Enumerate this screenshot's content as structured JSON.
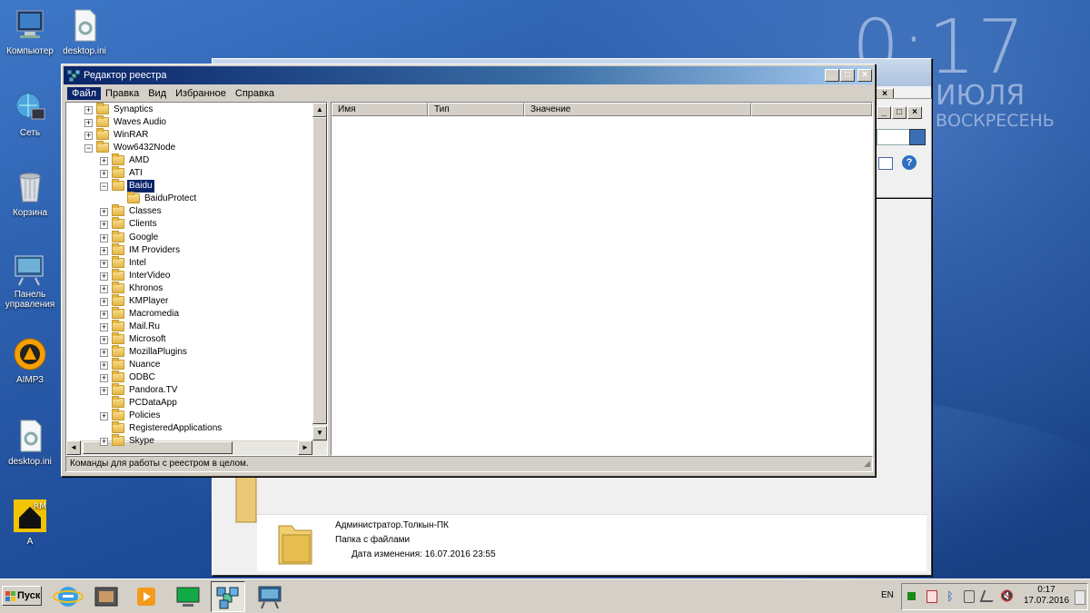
{
  "desktop": {
    "icons": [
      {
        "label": "Компьютер"
      },
      {
        "label": "desktop.ini"
      },
      {
        "label": "Сеть"
      },
      {
        "label": "Корзина"
      },
      {
        "label": "Панель управления"
      },
      {
        "label": "AIMP3"
      },
      {
        "label": "desktop.ini"
      },
      {
        "label": "A"
      }
    ],
    "gadget": {
      "time": "0:17",
      "month": "ИЮЛЯ",
      "day": "ВОСКРЕСЕНЬ"
    }
  },
  "regedit": {
    "title": "Редактор реестра",
    "menu": [
      "Файл",
      "Правка",
      "Вид",
      "Избранное",
      "Справка"
    ],
    "tree": [
      {
        "label": "Synaptics",
        "depth": 0,
        "expander": "+"
      },
      {
        "label": "Waves Audio",
        "depth": 0,
        "expander": "+"
      },
      {
        "label": "WinRAR",
        "depth": 0,
        "expander": "+"
      },
      {
        "label": "Wow6432Node",
        "depth": 0,
        "expander": "-"
      },
      {
        "label": "AMD",
        "depth": 1,
        "expander": "+"
      },
      {
        "label": "ATI",
        "depth": 1,
        "expander": "+"
      },
      {
        "label": "Baidu",
        "depth": 1,
        "expander": "-",
        "selected": true
      },
      {
        "label": "BaiduProtect",
        "depth": 2,
        "expander": ""
      },
      {
        "label": "Classes",
        "depth": 1,
        "expander": "+"
      },
      {
        "label": "Clients",
        "depth": 1,
        "expander": "+"
      },
      {
        "label": "Google",
        "depth": 1,
        "expander": "+"
      },
      {
        "label": "IM Providers",
        "depth": 1,
        "expander": "+"
      },
      {
        "label": "Intel",
        "depth": 1,
        "expander": "+"
      },
      {
        "label": "InterVideo",
        "depth": 1,
        "expander": "+"
      },
      {
        "label": "Khronos",
        "depth": 1,
        "expander": "+"
      },
      {
        "label": "KMPlayer",
        "depth": 1,
        "expander": "+"
      },
      {
        "label": "Macromedia",
        "depth": 1,
        "expander": "+"
      },
      {
        "label": "Mail.Ru",
        "depth": 1,
        "expander": "+"
      },
      {
        "label": "Microsoft",
        "depth": 1,
        "expander": "+"
      },
      {
        "label": "MozillaPlugins",
        "depth": 1,
        "expander": "+"
      },
      {
        "label": "Nuance",
        "depth": 1,
        "expander": "+"
      },
      {
        "label": "ODBC",
        "depth": 1,
        "expander": "+"
      },
      {
        "label": "Pandora.TV",
        "depth": 1,
        "expander": "+"
      },
      {
        "label": "PCDataApp",
        "depth": 1,
        "expander": ""
      },
      {
        "label": "Policies",
        "depth": 1,
        "expander": "+"
      },
      {
        "label": "RegisteredApplications",
        "depth": 1,
        "expander": ""
      },
      {
        "label": "Skype",
        "depth": 1,
        "expander": "+"
      }
    ],
    "columns": [
      "Имя",
      "Тип",
      "Значение"
    ],
    "status": "Команды для работы с реестром в целом."
  },
  "explorer_details": {
    "name": "Администратор.Толкын-ПК",
    "type": "Папка с файлами",
    "modified_label": "Дата изменения:",
    "modified_value": "16.07.2016 23:55"
  },
  "taskbar": {
    "start_label": "Пуск",
    "lang": "EN",
    "time": "0:17",
    "date": "17.07.2016"
  },
  "colors": {
    "title_active": "#0a246a",
    "selection": "#0a246a",
    "face": "#d4d0c8"
  }
}
